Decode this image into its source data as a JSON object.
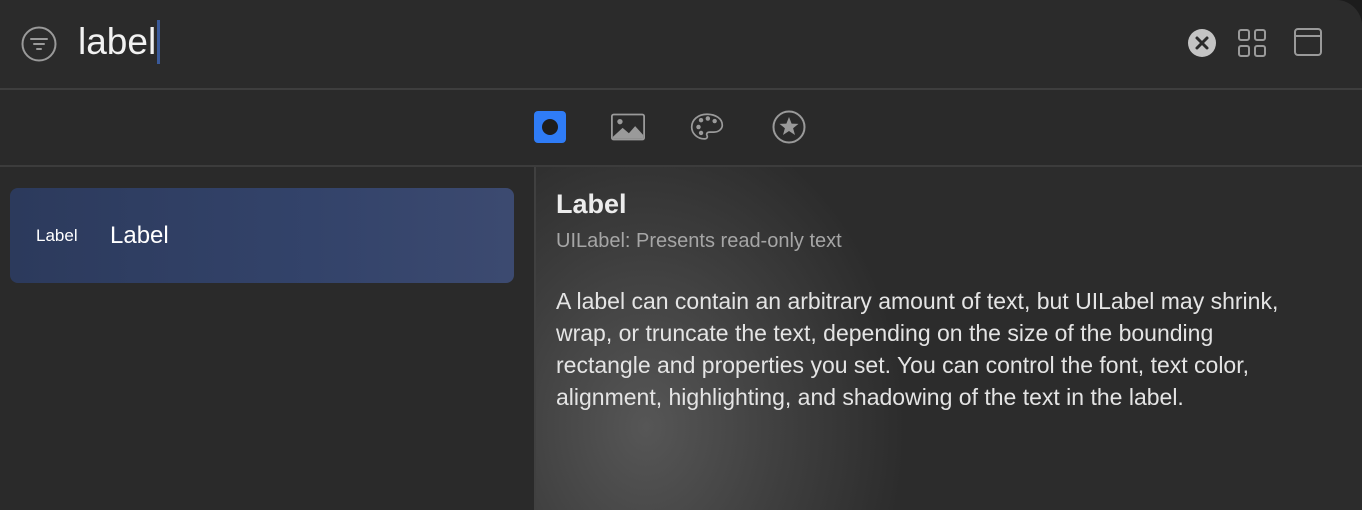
{
  "search": {
    "query": "label"
  },
  "toolbar": {
    "filter_icon": "filter-circle-icon",
    "clear_icon": "clear-search-icon",
    "grid_icon": "grid-view-icon",
    "window_icon": "window-icon"
  },
  "tabs": [
    {
      "icon": "objects-tab-icon",
      "selected": true
    },
    {
      "icon": "image-tab-icon",
      "selected": false
    },
    {
      "icon": "color-palette-tab-icon",
      "selected": false
    },
    {
      "icon": "star-tab-icon",
      "selected": false
    }
  ],
  "list": {
    "items": [
      {
        "preview": "Label",
        "title": "Label",
        "selected": true
      }
    ]
  },
  "detail": {
    "title": "Label",
    "subtitle": "UILabel: Presents read-only text",
    "body": "A label can contain an arbitrary amount of text, but UILabel may shrink, wrap, or truncate the text, depending on the size of the bounding rectangle and properties you set. You can control the font, text color, alignment, highlighting, and shadowing of the text in the label."
  },
  "colors": {
    "accent": "#2f7cf6",
    "selection": "#33436a",
    "background": "#2a2a2a"
  }
}
